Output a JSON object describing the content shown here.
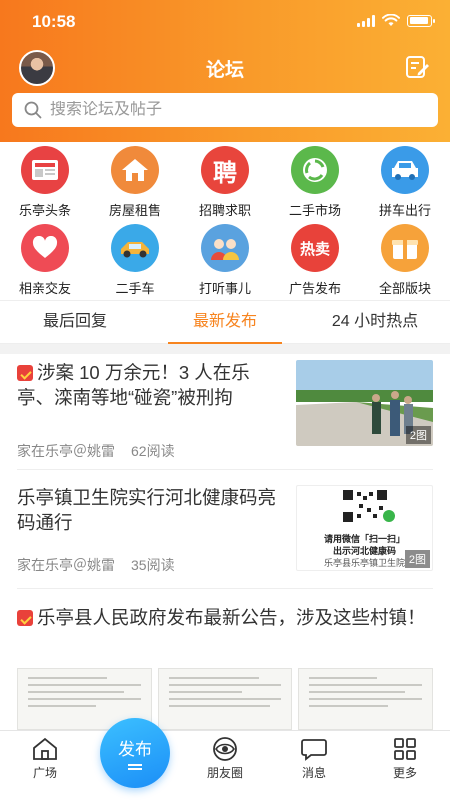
{
  "status": {
    "time": "10:58",
    "battery_level": 0.9
  },
  "header": {
    "title": "论坛"
  },
  "search": {
    "placeholder": "搜索论坛及帖子"
  },
  "categories": [
    {
      "label": "乐亭头条",
      "icon": "news-icon",
      "color": "#e84243"
    },
    {
      "label": "房屋租售",
      "icon": "house-icon",
      "color": "#f08a3b"
    },
    {
      "label": "招聘求职",
      "icon": "recruit-icon",
      "glyph": "聘",
      "color": "#e8453c"
    },
    {
      "label": "二手市场",
      "icon": "recycle-icon",
      "color": "#5bb84b"
    },
    {
      "label": "拼车出行",
      "icon": "carpool-icon",
      "color": "#3a9be8"
    },
    {
      "label": "相亲交友",
      "icon": "heart-icon",
      "color": "#ef4b55"
    },
    {
      "label": "二手车",
      "icon": "car-icon",
      "color": "#3aa9e8"
    },
    {
      "label": "打听事儿",
      "icon": "people-icon",
      "color": "#5aa2df"
    },
    {
      "label": "广告发布",
      "icon": "ad-icon",
      "glyph": "热卖",
      "color": "#e8423a"
    },
    {
      "label": "全部版块",
      "icon": "gift-icon",
      "color": "#f6a23a"
    }
  ],
  "tabs": [
    {
      "label": "最后回复",
      "active": false
    },
    {
      "label": "最新发布",
      "active": true
    },
    {
      "label": "24 小时热点",
      "active": false
    }
  ],
  "articles": [
    {
      "title": "涉案 10 万余元！3 人在乐亭、滦南等地“碰瓷”被刑拘",
      "author": "家在乐亭＠姚雷",
      "reads": "62阅读",
      "image_count": "2图",
      "flag": true
    },
    {
      "title": "乐亭镇卫生院实行河北健康码亮码通行",
      "author": "家在乐亭＠姚雷",
      "reads": "35阅读",
      "image_count": "2图",
      "flag": false,
      "qr_text": [
        "请用微信「扫一扫」",
        "出示河北健康码",
        "乐亭县乐亭镇卫生院"
      ]
    },
    {
      "title": "乐亭县人民政府发布最新公告，涉及这些村镇！",
      "flag": true
    }
  ],
  "tabbar": {
    "square": "广场",
    "publish": "发布",
    "friends": "朋友圈",
    "messages": "消息",
    "more": "更多"
  }
}
